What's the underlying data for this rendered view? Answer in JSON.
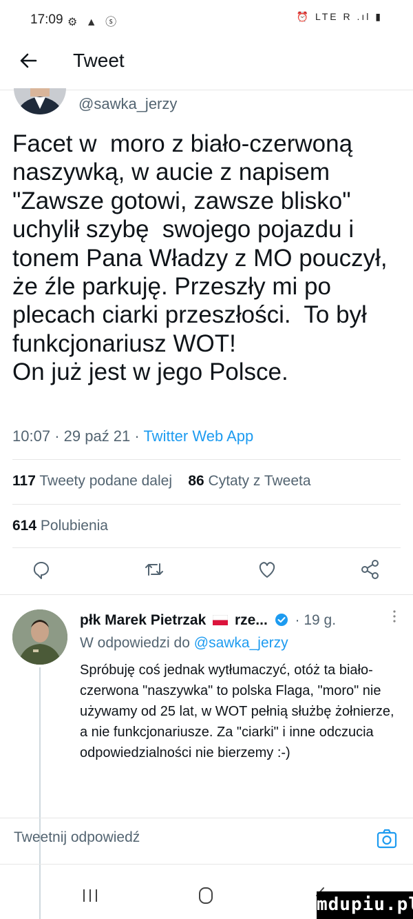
{
  "status_bar": {
    "time": "17:09",
    "left_icons": "⚙ ▲ ⓢ",
    "right_icons": "⏰ LTE R .ıl ▮"
  },
  "header": {
    "title": "Tweet"
  },
  "tweet": {
    "handle": "@sawka_jerzy",
    "text": "Facet w  moro z biało-czerwoną naszywką, w aucie z napisem \"Zawsze gotowi, zawsze blisko\" uchylił szybę  swojego pojazdu i tonem Pana Władzy z MO pouczył, że źle parkuję. Przeszły mi po plecach ciarki przeszłości.  To był funkcjonariusz WOT!\nOn już jest w jego Polsce.",
    "time": "10:07",
    "date": "29 paź 21",
    "sep1": "·",
    "sep2": "·",
    "source": "Twitter Web App",
    "retweets_count": "117",
    "retweets_label": "Tweety podane dalej",
    "quotes_count": "86",
    "quotes_label": "Cytaty z Tweeta",
    "likes_count": "614",
    "likes_label": "Polubienia"
  },
  "actions": [
    "reply-icon",
    "retweet-icon",
    "like-icon",
    "share-icon"
  ],
  "reply": {
    "name": "płk Marek Pietrzak",
    "name_suffix": "rze...",
    "dot": "·",
    "time": "19 g.",
    "replying_label": "W odpowiedzi do",
    "replying_handle": "@sawka_jerzy",
    "text": "Spróbuję coś jednak wytłumaczyć, otóż ta biało-czerwona \"naszywka\" to polska Flaga, \"moro\" nie używamy od 25 lat, w WOT pełnią służbę żołnierze, a nie funkcjonariusze. Za \"ciarki\" i inne odczucia odpowiedzialności nie bierzemy :-)"
  },
  "compose": {
    "placeholder": "Tweetnij odpowiedź"
  },
  "colors": {
    "link": "#1d9bf0",
    "secondary_text": "#536471",
    "divider": "#e6e6e6"
  },
  "watermark": "mdupiu.pl"
}
